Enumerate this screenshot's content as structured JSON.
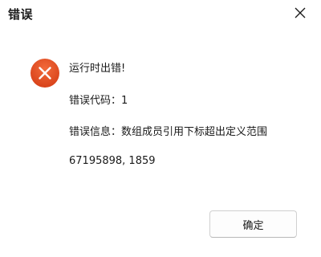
{
  "window": {
    "title": "错误",
    "close_icon": "close-icon"
  },
  "message": {
    "icon": "error-icon",
    "icon_color": "#e0491d",
    "line1": "运行时出错!",
    "line2": "错误代码：1",
    "line3": "错误信息：数组成员引用下标超出定义范围",
    "line4": "67195898, 1859"
  },
  "buttons": {
    "ok_label": "确定"
  }
}
